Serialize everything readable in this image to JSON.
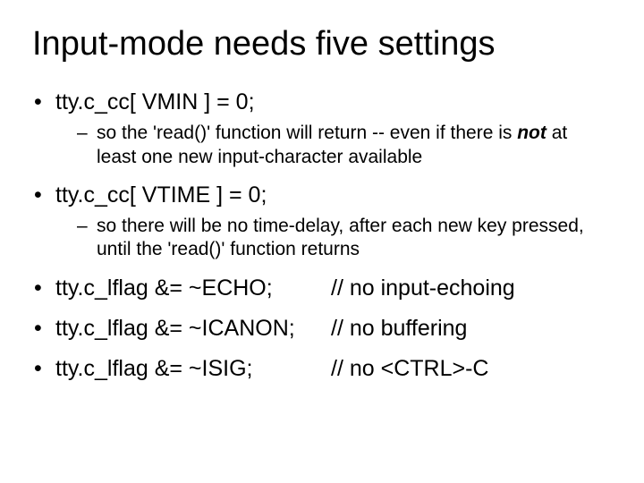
{
  "title": "Input-mode needs five settings",
  "b1": {
    "code": "tty.c_cc[ VMIN ] = 0;",
    "sub_a": "so the 'read()' function will return -- even if there is ",
    "sub_not": "not",
    "sub_b": " at least one new input-character available"
  },
  "b2": {
    "code": "tty.c_cc[ VTIME ] = 0;",
    "sub": "so there will be no time-delay, after each new key pressed, until the 'read()' function returns"
  },
  "b3": {
    "code": "tty.c_lflag &= ~ECHO;",
    "comment": "// no input-echoing"
  },
  "b4": {
    "code": "tty.c_lflag &= ~ICANON;",
    "comment": "// no buffering"
  },
  "b5": {
    "code": "tty.c_lflag &= ~ISIG;",
    "comment": "// no <CTRL>-C"
  }
}
